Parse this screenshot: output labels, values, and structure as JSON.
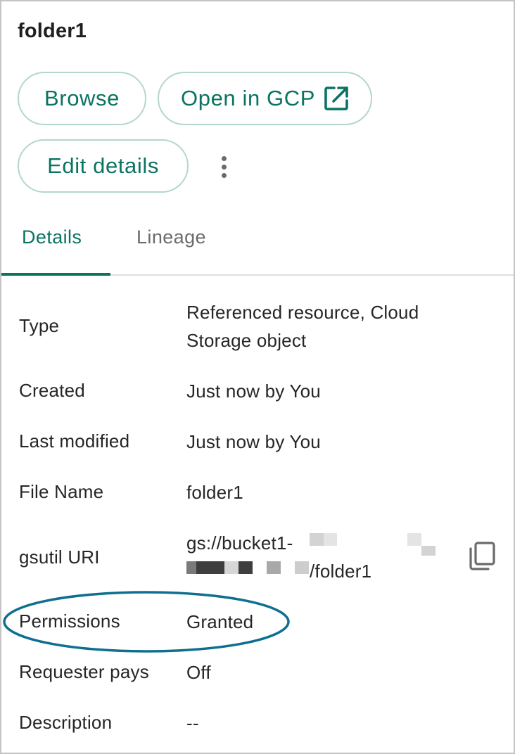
{
  "header": {
    "title": "folder1"
  },
  "actions": {
    "browse_label": "Browse",
    "open_gcp_label": "Open in GCP",
    "open_gcp_icon": "open-in-new-icon",
    "edit_label": "Edit details",
    "more_icon": "more-vert-icon"
  },
  "tabs": [
    {
      "label": "Details",
      "active": true
    },
    {
      "label": "Lineage",
      "active": false
    }
  ],
  "details": {
    "type": {
      "label": "Type",
      "value_line1": "Referenced resource, Cloud",
      "value_line2": "Storage object"
    },
    "created": {
      "label": "Created",
      "value": "Just now by You"
    },
    "last_modified": {
      "label": "Last modified",
      "value": "Just now by You"
    },
    "file_name": {
      "label": "File Name",
      "value": "folder1"
    },
    "gsutil_uri": {
      "label": "gsutil URI",
      "value_prefix": "gs://bucket1-",
      "value_suffix": "/folder1",
      "copy_icon": "copy-icon"
    },
    "permissions": {
      "label": "Permissions",
      "value": "Granted"
    },
    "requester_pays": {
      "label": "Requester pays",
      "value": "Off"
    },
    "description": {
      "label": "Description",
      "value": "--"
    }
  },
  "colors": {
    "accent": "#0b7361",
    "button_border": "#b3d6cf",
    "highlight_ellipse": "#0e6f8e"
  }
}
